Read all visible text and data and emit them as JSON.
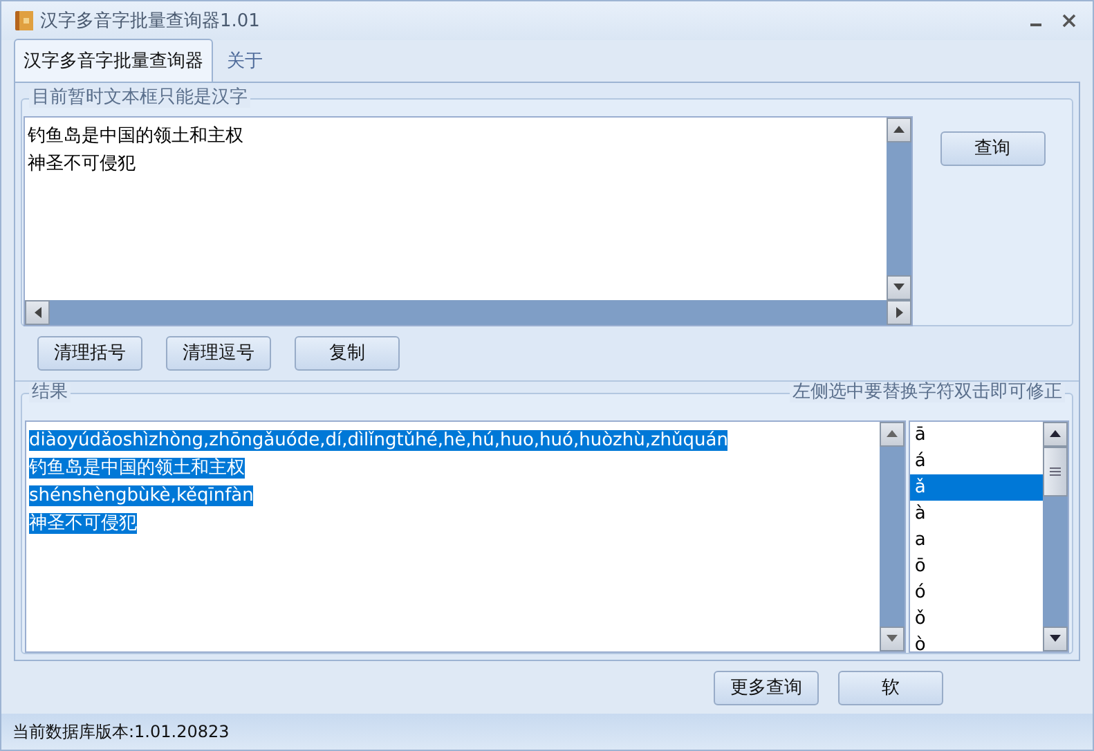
{
  "window": {
    "title": "汉字多音字批量查询器1.01"
  },
  "tabs": [
    {
      "label": "汉字多音字批量查询器",
      "selected": true
    },
    {
      "label": "关于",
      "selected": false
    }
  ],
  "input_group": {
    "legend": "目前暂时文本框只能是汉字",
    "lines": [
      "钓鱼岛是中国的领土和主权",
      "神圣不可侵犯"
    ],
    "query_button": "查询"
  },
  "tool_buttons": [
    "清理括号",
    "清理逗号",
    "复制"
  ],
  "result_group": {
    "legend": "结果",
    "hint": "左侧选中要替换字符双击即可修正",
    "lines": [
      {
        "text": "diàoyúdǎoshìzhòng,zhōngǎuóde,dí,dìlǐngtǔhé,hè,hú,huo,huó,huòzhù,zhǔquán",
        "selected": true
      },
      {
        "text": "钓鱼岛是中国的领土和主权",
        "selected": true
      },
      {
        "text": "shénshèngbùkè,kěqīnfàn",
        "selected": true
      },
      {
        "text": "神圣不可侵犯",
        "selected": true
      }
    ],
    "characters": [
      {
        "label": "ā",
        "selected": false
      },
      {
        "label": "á",
        "selected": false
      },
      {
        "label": "ǎ",
        "selected": true
      },
      {
        "label": "à",
        "selected": false
      },
      {
        "label": "a",
        "selected": false
      },
      {
        "label": "ō",
        "selected": false
      },
      {
        "label": "ó",
        "selected": false
      },
      {
        "label": "ǒ",
        "selected": false
      },
      {
        "label": "ò",
        "selected": false
      }
    ]
  },
  "bottom_buttons": [
    "更多查询",
    "软"
  ],
  "status_bar": "当前数据库版本:1.01.20823"
}
